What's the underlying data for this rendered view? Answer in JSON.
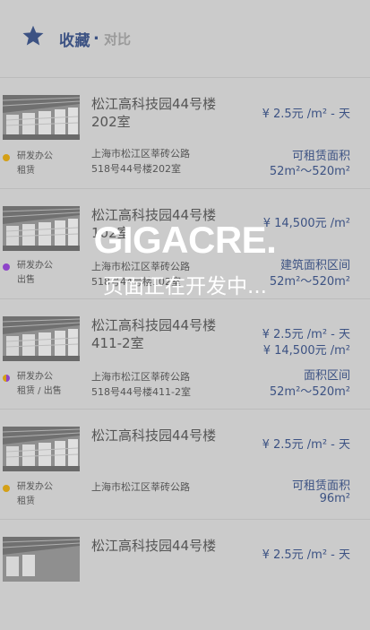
{
  "header": {
    "title": "收藏",
    "separator": ".",
    "compare": "对比"
  },
  "items": [
    {
      "name": "松江高科技园44号楼202室",
      "tag_line1": "研发办公",
      "tag_line2": "租赁",
      "dot_color": "#d4a017",
      "price1": "¥ 2.5元 /m² - 天",
      "price2": "",
      "address_line1": "上海市松江区莘砖公路",
      "address_line2": "518号44号楼202室",
      "area_label": "可租赁面积",
      "area_value": "52m²～520m²"
    },
    {
      "name": "松江高科技园44号楼102室",
      "tag_line1": "研发办公",
      "tag_line2": "出售",
      "dot_color": "#8e44c9",
      "price1": "¥ 14,500元 /m²",
      "price2": "",
      "address_line1": "上海市松江区莘砖公路",
      "address_line2": "518号44号楼102室",
      "area_label": "建筑面积区间",
      "area_value": "52m²～520m²"
    },
    {
      "name": "松江高科技园44号楼411-2室",
      "tag_line1": "研发办公",
      "tag_line2": "租赁 / 出售",
      "dot_color": "#d4a017",
      "price1": "¥ 2.5元 /m² - 天",
      "price2": "¥ 14,500元 /m²",
      "address_line1": "上海市松江区莘砖公路",
      "address_line2": "518号44号楼411-2室",
      "area_label": "面积区间",
      "area_value": "52m²～520m²"
    },
    {
      "name": "松江高科技园44号楼",
      "tag_line1": "研发办公",
      "tag_line2": "租赁",
      "dot_color": "#d4a017",
      "price1": "¥ 2.5元 /m² - 天",
      "price2": "",
      "address_line1": "上海市松江区莘砖公路",
      "address_line2": "",
      "area_label": "可租赁面积",
      "area_value": "96m²"
    },
    {
      "name": "松江高科技园44号楼",
      "tag_line1": "",
      "tag_line2": "",
      "dot_color": "#d4a017",
      "price1": "¥ 2.5元 /m² - 天",
      "price2": "",
      "address_line1": "",
      "address_line2": "",
      "area_label": "",
      "area_value": ""
    }
  ],
  "overlay": {
    "logo": "GIGACRE.",
    "message": "页面正在开发中..."
  },
  "colors": {
    "accent": "#3c5283",
    "background": "#cbcbcb"
  }
}
